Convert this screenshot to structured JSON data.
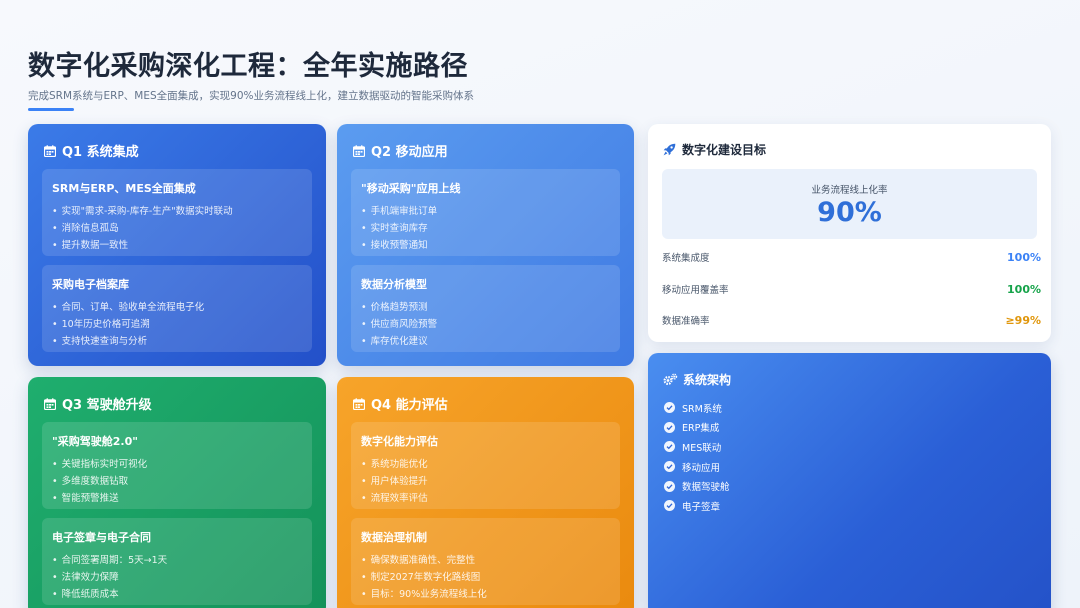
{
  "header": {
    "title": "数字化采购深化工程：全年实施路径",
    "subtitle": "完成SRM系统与ERP、MES全面集成，实现90%业务流程线上化，建立数据驱动的智能采购体系"
  },
  "quarters": [
    {
      "title": "Q1 系统集成",
      "items": [
        {
          "title": "SRM与ERP、MES全面集成",
          "bullets": [
            "实现\"需求-采购-库存-生产\"数据实时联动",
            "消除信息孤岛",
            "提升数据一致性"
          ]
        },
        {
          "title": "采购电子档案库",
          "bullets": [
            "合同、订单、验收单全流程电子化",
            "10年历史价格可追溯",
            "支持快速查询与分析"
          ]
        }
      ]
    },
    {
      "title": "Q2 移动应用",
      "items": [
        {
          "title": "\"移动采购\"应用上线",
          "bullets": [
            "手机端审批订单",
            "实时查询库存",
            "接收预警通知"
          ]
        },
        {
          "title": "数据分析模型",
          "bullets": [
            "价格趋势预测",
            "供应商风险预警",
            "库存优化建议"
          ]
        }
      ]
    },
    {
      "title": "Q3 驾驶舱升级",
      "items": [
        {
          "title": "\"采购驾驶舱2.0\"",
          "bullets": [
            "关键指标实时可视化",
            "多维度数据钻取",
            "智能预警推送"
          ]
        },
        {
          "title": "电子签章与电子合同",
          "bullets": [
            "合同签署周期：5天→1天",
            "法律效力保障",
            "降低纸质成本"
          ]
        }
      ]
    },
    {
      "title": "Q4 能力评估",
      "items": [
        {
          "title": "数字化能力评估",
          "bullets": [
            "系统功能优化",
            "用户体验提升",
            "流程效率评估"
          ]
        },
        {
          "title": "数据治理机制",
          "bullets": [
            "确保数据准确性、完整性",
            "制定2027年数字化路线图",
            "目标：90%业务流程线上化"
          ]
        }
      ]
    }
  ],
  "goals": {
    "title": "数字化建设目标",
    "kpi_label": "业务流程线上化率",
    "kpi_value": "90%",
    "metrics": [
      {
        "label": "系统集成度",
        "value": "100%"
      },
      {
        "label": "移动应用覆盖率",
        "value": "100%"
      },
      {
        "label": "数据准确率",
        "value": "≥99%"
      }
    ]
  },
  "architecture": {
    "title": "系统架构",
    "items": [
      "SRM系统",
      "ERP集成",
      "MES联动",
      "移动应用",
      "数据驾驶舱",
      "电子签章"
    ]
  },
  "colors": {
    "q1": "#2f66d8",
    "q2": "#4d8aea",
    "q3": "#1aa065",
    "q4": "#f19a1c",
    "kpi": "#2f6fd8",
    "metric_blue": "#3b82f6",
    "metric_green": "#16a34a",
    "metric_amber": "#e0960b"
  },
  "icons": [
    "calendar-icon",
    "rocket-icon",
    "cogs-icon",
    "check-circle-icon"
  ]
}
